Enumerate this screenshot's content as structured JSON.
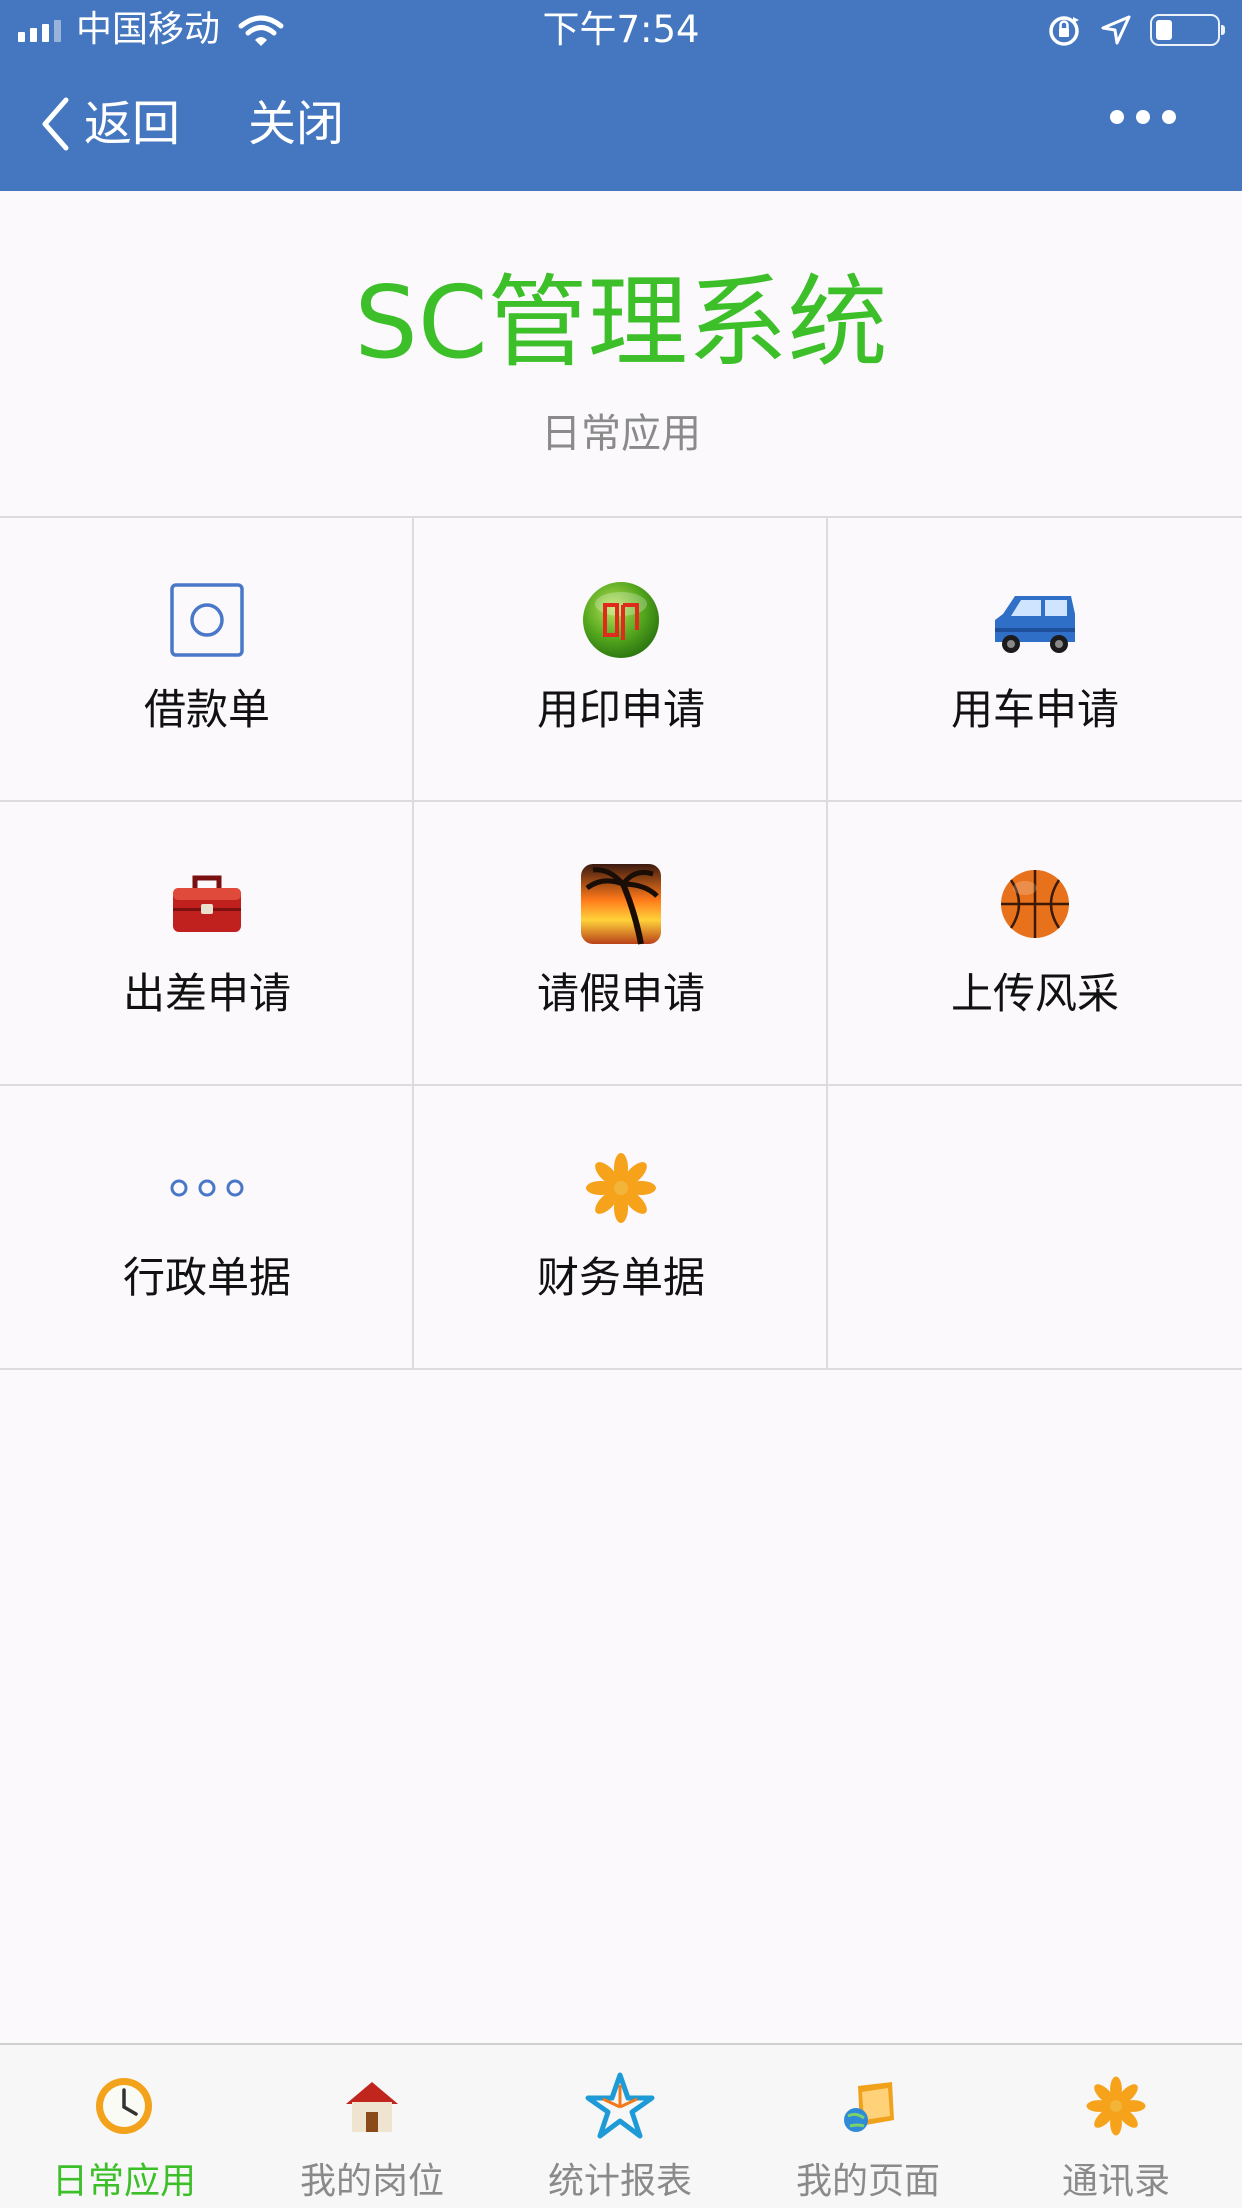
{
  "status_bar": {
    "carrier": "中国移动",
    "time": "下午7:54",
    "battery_level": 0.25
  },
  "nav": {
    "back_label": "返回",
    "close_label": "关闭"
  },
  "header": {
    "title": "SC管理系统",
    "subtitle": "日常应用"
  },
  "grid": {
    "items": [
      {
        "label": "借款单",
        "icon": "circle-square-icon"
      },
      {
        "label": "用印申请",
        "icon": "seal-icon"
      },
      {
        "label": "用车申请",
        "icon": "car-icon"
      },
      {
        "label": "出差申请",
        "icon": "toolbox-icon"
      },
      {
        "label": "请假申请",
        "icon": "palm-sunset-icon"
      },
      {
        "label": "上传风采",
        "icon": "basketball-icon"
      },
      {
        "label": "行政单据",
        "icon": "three-dots-icon"
      },
      {
        "label": "财务单据",
        "icon": "flower-icon"
      }
    ]
  },
  "tabs": [
    {
      "label": "日常应用",
      "icon": "clock-icon",
      "active": true
    },
    {
      "label": "我的岗位",
      "icon": "house-icon",
      "active": false
    },
    {
      "label": "统计报表",
      "icon": "star-icon",
      "active": false
    },
    {
      "label": "我的页面",
      "icon": "folder-globe-icon",
      "active": false
    },
    {
      "label": "通讯录",
      "icon": "flower-icon",
      "active": false
    }
  ],
  "colors": {
    "nav_bg": "#4477c0",
    "title_green": "#3dbf2a",
    "page_bg": "#fbf9fc"
  }
}
